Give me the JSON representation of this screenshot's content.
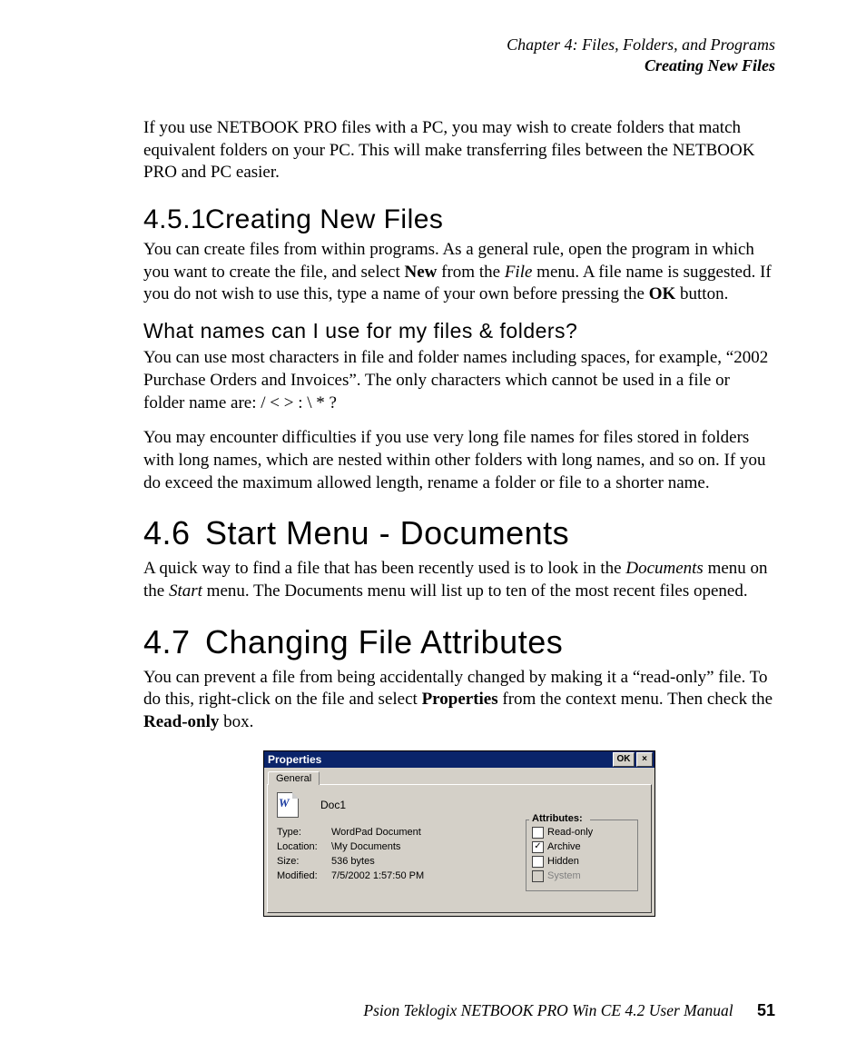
{
  "header": {
    "chapter": "Chapter 4:  Files, Folders, and Programs",
    "section": "Creating New Files"
  },
  "intro": {
    "p1a": "If you use NETBOOK PRO files with a PC, you may wish to create folders that match equivalent folders on your PC. This will make transferring files between the NETBOOK PRO and PC easier."
  },
  "s451": {
    "num": "4.5.1",
    "title": "Creating New Files",
    "p_a": "You can create files from within programs. As a general rule, open the program in which you want to create the file, and select ",
    "p_new": "New",
    "p_b": " from the ",
    "p_file": "File",
    "p_c": " menu. A file name is suggested. If you do not wish to use this, type a name of your own before pressing the ",
    "p_ok": "OK",
    "p_d": " button.",
    "sub_title": "What names can I use for my files & folders?",
    "sub_p1": "You can use most characters in file and folder names including spaces, for example, “2002 Purchase Orders and Invoices”. The only characters which cannot be used in a file or folder name are: / < > : \\ * ?",
    "sub_p2": "You may encounter difficulties if you use very long file names for files stored in folders with long names, which are nested within other folders with long names, and so on. If you do exceed the maximum allowed length, rename a folder or file to a shorter name."
  },
  "s46": {
    "num": "4.6",
    "title": "Start Menu - Documents",
    "p_a": "A quick way to find a file that has been recently used is to look in the ",
    "p_docs": "Documents",
    "p_b": " menu on the ",
    "p_start": "Start",
    "p_c": " menu. The Documents menu will list up to ten of the most recent files opened."
  },
  "s47": {
    "num": "4.7",
    "title": "Changing File Attributes",
    "p_a": "You can prevent a file from being accidentally changed by making it a “read-only” file. To do this, right-click on the file and select ",
    "p_props": "Properties",
    "p_b": " from the context menu. Then check the ",
    "p_ro": "Read-only",
    "p_c": " box."
  },
  "dialog": {
    "title": "Properties",
    "ok": "OK",
    "close": "×",
    "tab": "General",
    "docname": "Doc1",
    "icon_letter": "W",
    "rows": [
      {
        "label": "Type:",
        "value": "WordPad Document"
      },
      {
        "label": "Location:",
        "value": "\\My Documents"
      },
      {
        "label": "Size:",
        "value": "536 bytes"
      },
      {
        "label": "Modified:",
        "value": "7/5/2002 1:57:50 PM"
      }
    ],
    "attrs_legend": "Attributes:",
    "attrs": [
      {
        "label": "Read-only",
        "checked": false,
        "disabled": false
      },
      {
        "label": "Archive",
        "checked": true,
        "disabled": false
      },
      {
        "label": "Hidden",
        "checked": false,
        "disabled": false
      },
      {
        "label": "System",
        "checked": false,
        "disabled": true
      }
    ]
  },
  "footer": {
    "text": "Psion Teklogix NETBOOK PRO Win CE 4.2 User Manual",
    "page": "51"
  }
}
